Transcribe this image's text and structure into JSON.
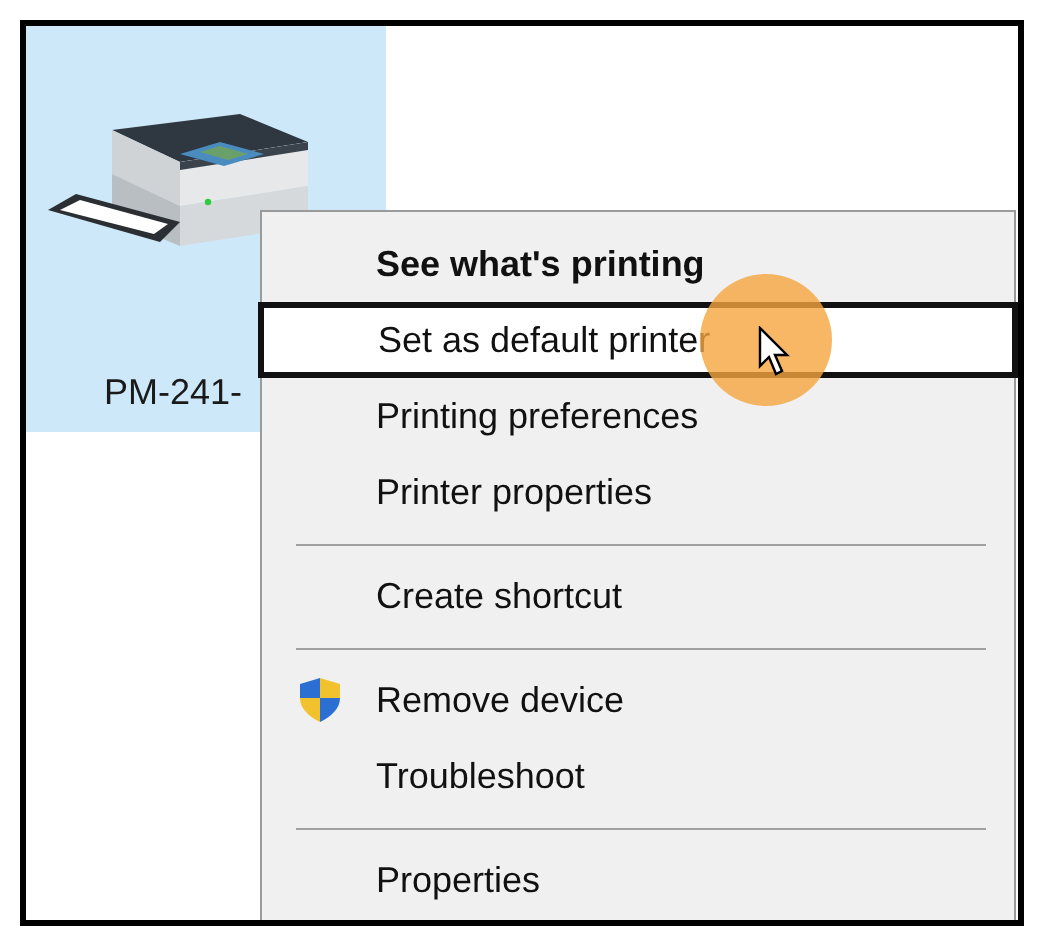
{
  "device": {
    "label": "PM-241-",
    "selected": true
  },
  "context_menu": {
    "items": [
      {
        "kind": "item",
        "label": "See what's printing",
        "bold": true,
        "selected": false
      },
      {
        "kind": "item",
        "label": "Set as default printer",
        "bold": false,
        "selected": true
      },
      {
        "kind": "item",
        "label": "Printing preferences",
        "bold": false,
        "selected": false
      },
      {
        "kind": "item",
        "label": "Printer properties",
        "bold": false,
        "selected": false
      },
      {
        "kind": "separator"
      },
      {
        "kind": "item",
        "label": "Create shortcut",
        "bold": false,
        "selected": false
      },
      {
        "kind": "separator"
      },
      {
        "kind": "shield_item",
        "label": "Remove device",
        "bold": false,
        "selected": false
      },
      {
        "kind": "item",
        "label": "Troubleshoot",
        "bold": false,
        "selected": false
      },
      {
        "kind": "separator"
      },
      {
        "kind": "item",
        "label": "Properties",
        "bold": false,
        "selected": false
      }
    ]
  }
}
